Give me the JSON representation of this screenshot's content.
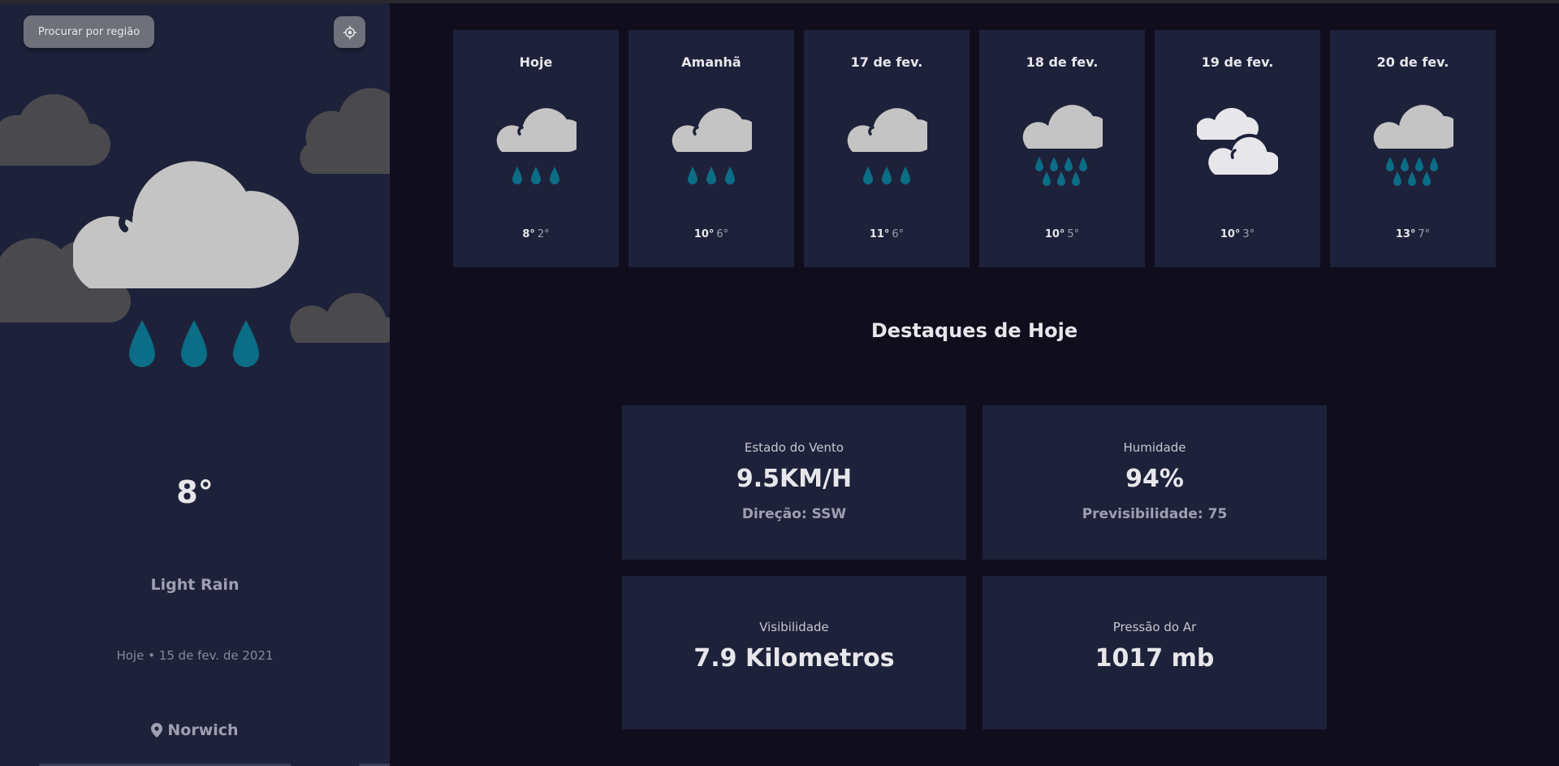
{
  "sidebar": {
    "search_label": "Procurar por região",
    "locate_icon": "crosshair-icon",
    "current_icon": "light-rain-icon",
    "temperature": "8°",
    "description": "Light Rain",
    "date": "Hoje • 15 de fev. de 2021",
    "location_icon": "location-pin-icon",
    "location": "Norwich"
  },
  "forecast": [
    {
      "day": "Hoje",
      "icon": "light-rain-icon",
      "max": "8°",
      "min": "2°"
    },
    {
      "day": "Amanhã",
      "icon": "light-rain-icon",
      "max": "10°",
      "min": "6°"
    },
    {
      "day": "17 de fev.",
      "icon": "light-rain-icon",
      "max": "11°",
      "min": "6°"
    },
    {
      "day": "18 de fev.",
      "icon": "heavy-rain-icon",
      "max": "10°",
      "min": "5°"
    },
    {
      "day": "19 de fev.",
      "icon": "heavy-cloud-icon",
      "max": "10°",
      "min": "3°"
    },
    {
      "day": "20 de fev.",
      "icon": "heavy-rain-icon",
      "max": "13°",
      "min": "7°"
    }
  ],
  "highlights": {
    "title": "Destaques de Hoje",
    "wind": {
      "label": "Estado do Vento",
      "value": "9.5KM/H",
      "sub": "Direção: SSW"
    },
    "humidity": {
      "label": "Humidade",
      "value": "94%",
      "sub": "Previsibilidade: 75"
    },
    "visibility": {
      "label": "Visibilidade",
      "value": "7.9 Kilometros"
    },
    "pressure": {
      "label": "Pressão do Ar",
      "value": "1017 mb"
    }
  },
  "colors": {
    "background": "#100e1d",
    "panel": "#1e213a",
    "button": "#6e707a",
    "cloud": "#c4c4c4",
    "rain": "#0b6d86",
    "text": "#e7e7eb",
    "muted": "#a09fb1"
  }
}
